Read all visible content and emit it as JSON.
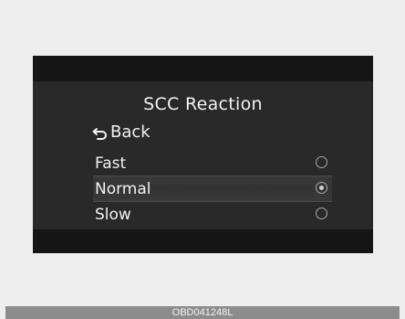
{
  "screen": {
    "title": "SCC Reaction",
    "back_label": "Back",
    "options": [
      {
        "label": "Fast",
        "selected": false
      },
      {
        "label": "Normal",
        "selected": true
      },
      {
        "label": "Slow",
        "selected": false
      }
    ]
  },
  "caption": "OBD041248L",
  "colors": {
    "screen_bg": "#292929",
    "bar_bg": "#161616",
    "text": "#f2f2f2",
    "caption_bg": "#8c8c8c"
  },
  "icons": {
    "back": "back-arrow-icon",
    "radio": "radio-button-icon"
  }
}
